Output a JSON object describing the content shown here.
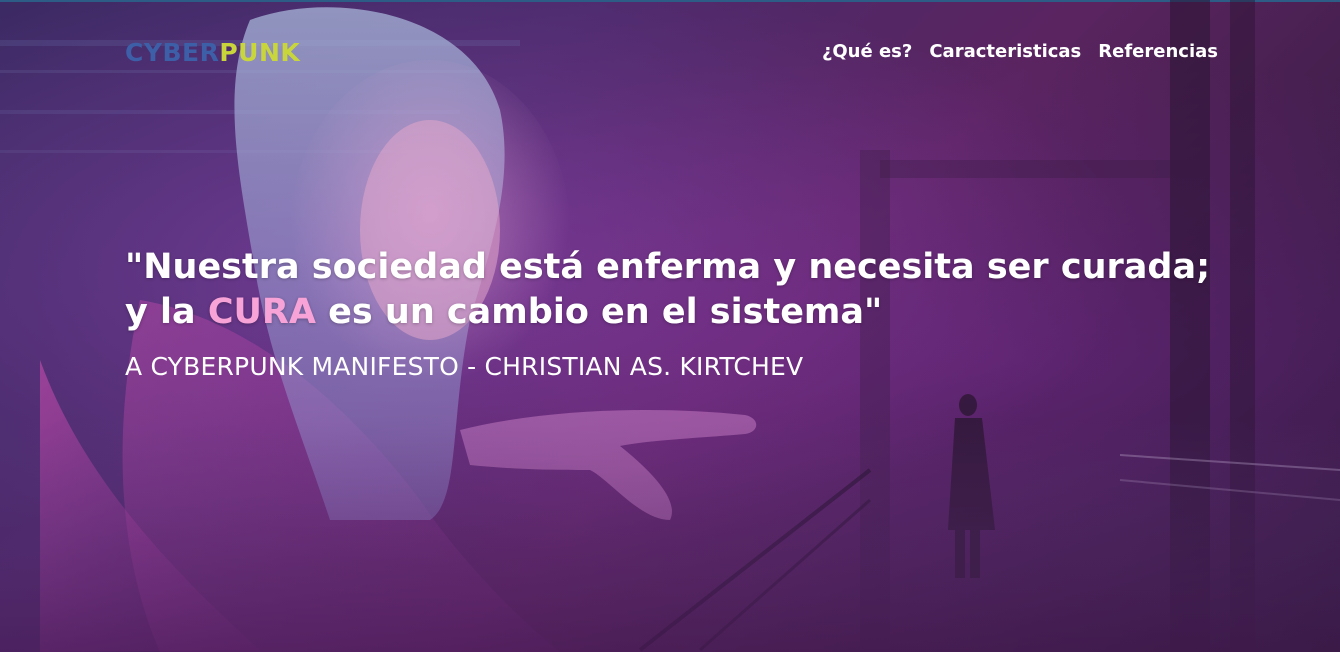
{
  "brand": {
    "part1": "CYBER",
    "part2": "PUNK",
    "color_part1": "#3d5fa8",
    "color_part2": "#c9d63b"
  },
  "nav": {
    "items": [
      {
        "label": "¿Qué es?"
      },
      {
        "label": "Caracteristicas"
      },
      {
        "label": "Referencias"
      }
    ]
  },
  "hero": {
    "quote_line1": "\"Nuestra sociedad está enferma y necesita ser curada;",
    "quote_line2_pre": "y la ",
    "quote_highlight": "CURA",
    "quote_line2_post": " es un cambio en el sistema\"",
    "highlight_color": "#f7a3d8",
    "attribution": "A CYBERPUNK MANIFESTO - CHRISTIAN AS. KIRTCHEV"
  }
}
